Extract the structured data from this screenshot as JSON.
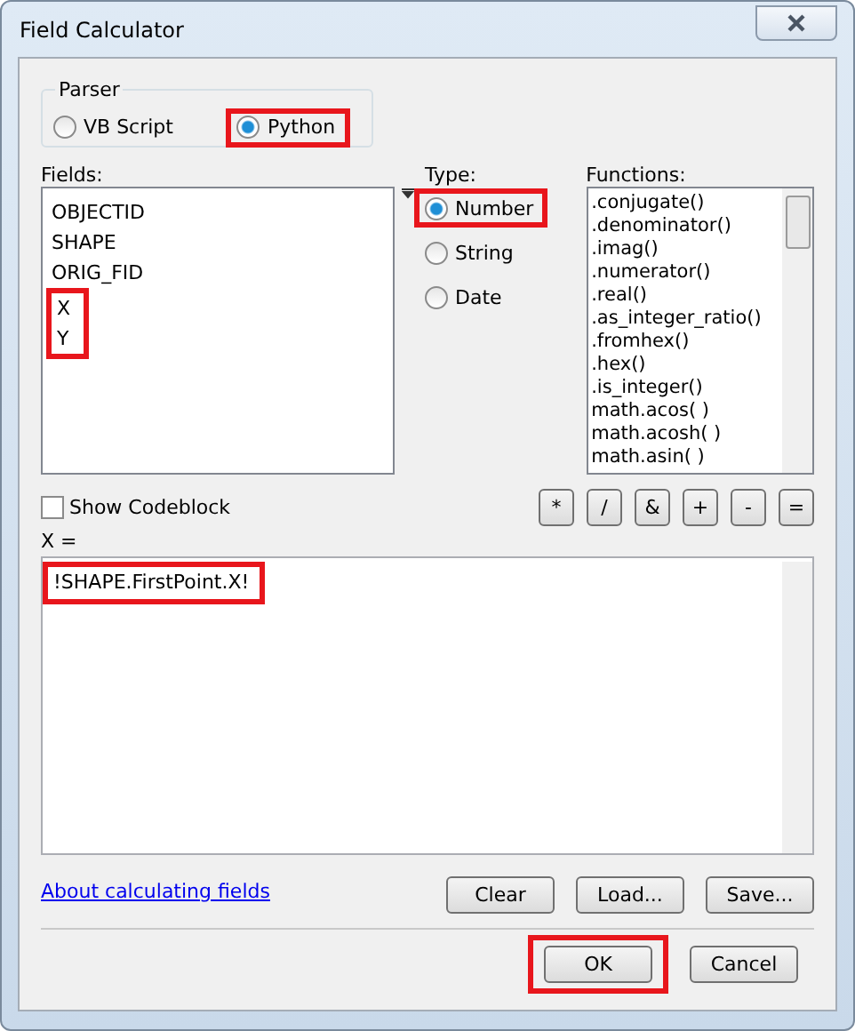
{
  "window": {
    "title": "Field Calculator"
  },
  "parser": {
    "label": "Parser",
    "options": [
      {
        "label": "VB Script",
        "selected": false,
        "highlighted": false
      },
      {
        "label": "Python",
        "selected": true,
        "highlighted": true
      }
    ]
  },
  "fields": {
    "label": "Fields:",
    "items": [
      {
        "label": "OBJECTID",
        "highlighted": false
      },
      {
        "label": "SHAPE",
        "highlighted": false
      },
      {
        "label": "ORIG_FID",
        "highlighted": false
      },
      {
        "label": "X",
        "highlighted": true
      },
      {
        "label": "Y",
        "highlighted": true
      }
    ]
  },
  "type": {
    "label": "Type:",
    "options": [
      {
        "label": "Number",
        "selected": true,
        "highlighted": true
      },
      {
        "label": "String",
        "selected": false,
        "highlighted": false
      },
      {
        "label": "Date",
        "selected": false,
        "highlighted": false
      }
    ]
  },
  "functions": {
    "label": "Functions:",
    "items": [
      ".conjugate()",
      ".denominator()",
      ".imag()",
      ".numerator()",
      ".real()",
      ".as_integer_ratio()",
      ".fromhex()",
      ".hex()",
      ".is_integer()",
      "math.acos( )",
      "math.acosh( )",
      "math.asin( )"
    ]
  },
  "show_codeblock": {
    "label": "Show Codeblock",
    "checked": false
  },
  "operators": [
    "*",
    "/",
    "&",
    "+",
    "-",
    "="
  ],
  "expression": {
    "label": "X =",
    "value": "!SHAPE.FirstPoint.X!",
    "highlighted": true
  },
  "help_link": "About calculating fields",
  "file_buttons": [
    "Clear",
    "Load...",
    "Save..."
  ],
  "dialog_buttons": [
    {
      "label": "OK",
      "highlighted": true
    },
    {
      "label": "Cancel",
      "highlighted": false
    }
  ]
}
